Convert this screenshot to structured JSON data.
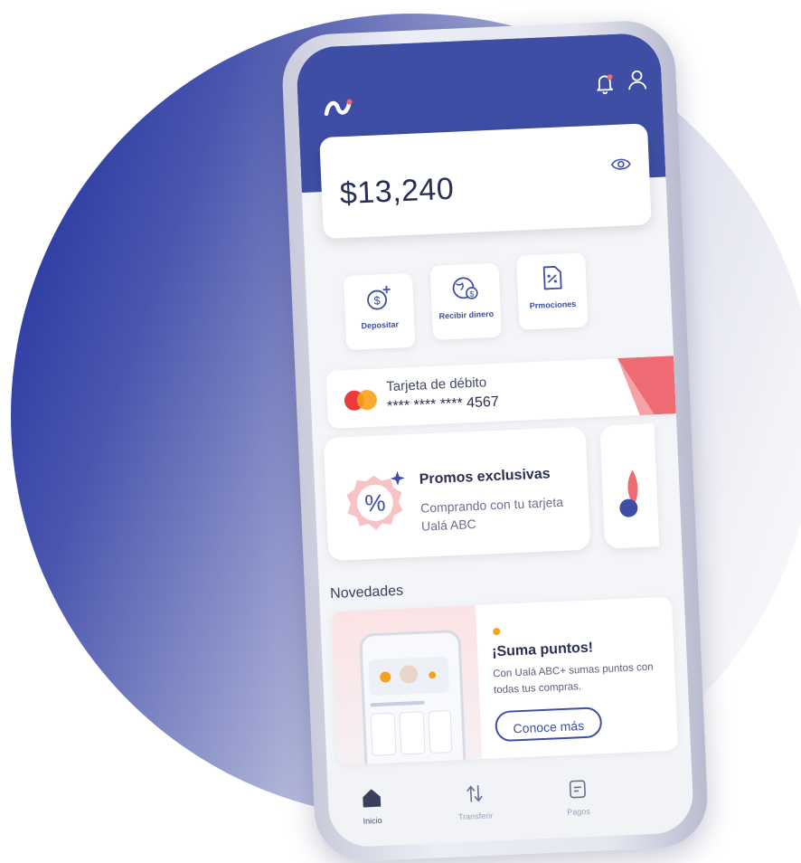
{
  "colors": {
    "primary": "#3e4ea4",
    "accent": "#ef6b73",
    "text_dark": "#2a2f55"
  },
  "header": {
    "logo_icon": "uala-logo-icon",
    "notification_icon": "bell-icon",
    "profile_icon": "user-icon"
  },
  "balance": {
    "amount": "$13,240",
    "toggle_icon": "eye-icon"
  },
  "actions": [
    {
      "label": "Depositar",
      "icon": "deposit-icon"
    },
    {
      "label": "Recibir dinero",
      "icon": "receive-money-icon"
    },
    {
      "label": "Prmociones",
      "icon": "promotions-icon"
    }
  ],
  "debit_card": {
    "title": "Tarjeta de débito",
    "number": "**** **** **** 4567",
    "brand_icon": "mastercard-icon"
  },
  "promo": {
    "title": "Promos exclusivas",
    "description": "Comprando con tu tarjeta Ualá ABC",
    "badge": "%"
  },
  "news": {
    "section_title": "Novedades",
    "heading": "¡Suma puntos!",
    "description": "Con Ualá ABC+ sumas puntos con todas tus compras.",
    "button_label": "Conoce más"
  },
  "nav": [
    {
      "label": "Inicio",
      "icon": "home-icon",
      "active": true
    },
    {
      "label": "Transferir",
      "icon": "transfer-icon",
      "active": false
    },
    {
      "label": "Pagos",
      "icon": "payments-icon",
      "active": false
    }
  ]
}
